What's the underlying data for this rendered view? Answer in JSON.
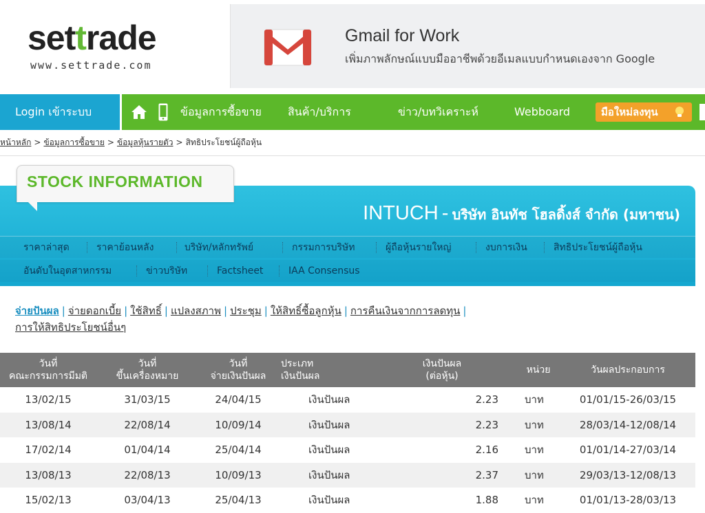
{
  "logo": {
    "word_a": "set",
    "word_b": "t",
    "word_c": "rade",
    "url": "www.settrade.com"
  },
  "ad": {
    "title": "Gmail for Work",
    "subtitle": "เพิ่มภาพลักษณ์แบบมืออาชีพด้วยอีเมลแบบกำหนดเองจาก Google"
  },
  "navbar": {
    "login": "Login เข้าระบบ",
    "items": [
      "ข้อมูลการซื้อขาย",
      "สินค้า/บริการ",
      "ข่าว/บทวิเคราะห์",
      "Webboard"
    ],
    "new_investor": "มือใหม่ลงทุน"
  },
  "breadcrumb": {
    "links": [
      "หน้าหลัก",
      "ข้อมูลการซื้อขาย",
      "ข้อมูลหุ้นรายตัว"
    ],
    "current": "สิทธิประโยชน์ผู้ถือหุ้น",
    "separator": ">"
  },
  "stock": {
    "tab_label": "STOCK INFORMATION",
    "symbol": "INTUCH",
    "dash": "-",
    "company_name": "บริษัท อินทัช โฮลดิ้งส์ จำกัด (มหาชน)",
    "menu_row1": [
      "ราคาล่าสุด",
      "ราคาย้อนหลัง",
      "บริษัท/หลักทรัพย์",
      "กรรมการบริษัท",
      "ผู้ถือหุ้นรายใหญ่",
      "งบการเงิน",
      "สิทธิประโยชน์ผู้ถือหุ้น"
    ],
    "menu_row2": [
      "อันดับในอุตสาหกรรม",
      "ข่าวบริษัท",
      "Factsheet",
      "IAA Consensus"
    ]
  },
  "subtabs": [
    "จ่ายปันผล",
    "จ่ายดอกเบี้ย",
    "ใช้สิทธิ์",
    "แปลงสภาพ",
    "ประชุม",
    "ให้สิทธิ์ซื้อลูกหุ้น",
    "การคืนเงินจากการลดทุน",
    "การให้สิทธิประโยชน์อื่นๆ"
  ],
  "table": {
    "headers": [
      [
        "วันที่",
        "คณะกรรมการมีมติ"
      ],
      [
        "วันที่",
        "ขึ้นเครื่องหมาย"
      ],
      [
        "วันที่",
        "จ่ายเงินปันผล"
      ],
      [
        "ประเภท",
        "เงินปันผล"
      ],
      [
        "เงินปันผล",
        "(ต่อหุ้น)"
      ],
      [
        "หน่วย"
      ],
      [
        "วันผลประกอบการ"
      ]
    ],
    "rows": [
      [
        "13/02/15",
        "31/03/15",
        "24/04/15",
        "เงินปันผล",
        "2.23",
        "บาท",
        "01/01/15-26/03/15"
      ],
      [
        "13/08/14",
        "22/08/14",
        "10/09/14",
        "เงินปันผล",
        "2.23",
        "บาท",
        "28/03/14-12/08/14"
      ],
      [
        "17/02/14",
        "01/04/14",
        "25/04/14",
        "เงินปันผล",
        "2.16",
        "บาท",
        "01/01/14-27/03/14"
      ],
      [
        "13/08/13",
        "22/08/13",
        "10/09/13",
        "เงินปันผล",
        "2.37",
        "บาท",
        "29/03/13-12/08/13"
      ],
      [
        "15/02/13",
        "03/04/13",
        "25/04/13",
        "เงินปันผล",
        "1.88",
        "บาท",
        "01/01/13-28/03/13"
      ]
    ]
  },
  "colors": {
    "brand_green": "#5cb82a",
    "login_blue": "#1ba5d1",
    "panel_cyan": "#2fc1e0",
    "accent_orange": "#f3a12a",
    "header_gray": "#777777"
  }
}
